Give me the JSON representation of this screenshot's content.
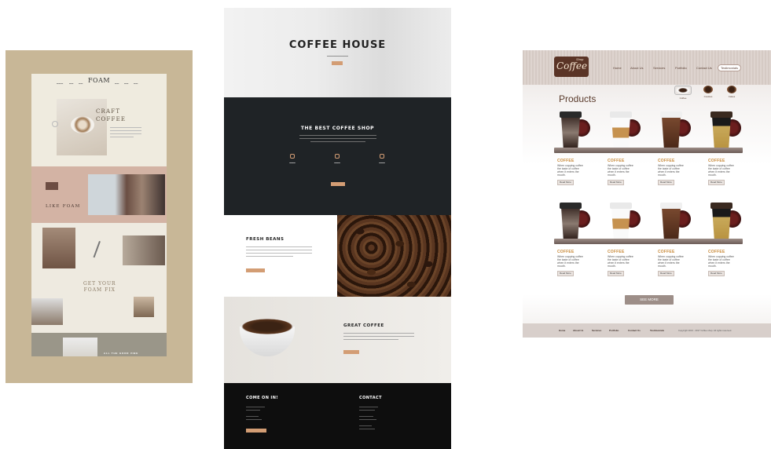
{
  "foam": {
    "logo": "FOAM",
    "hero_heading_line1": "CRAFT",
    "hero_heading_line2": "COFFEE",
    "band_heading": "LIKE FOAM",
    "fix_line1": "GET YOUR",
    "fix_line2": "FOAM FIX",
    "footer_heading": "ALL THE GOOD VIBE"
  },
  "coffee_house": {
    "hero_title": "COFFEE HOUSE",
    "section_title": "THE BEST COFFEE SHOP",
    "beans_title": "FRESH BEANS",
    "great_title": "GREAT COFFEE",
    "footer_left_title": "COME ON IN!",
    "footer_right_title": "CONTACT"
  },
  "coffee_shop": {
    "logo_main": "Coffee",
    "logo_sub": "Shop",
    "nav": [
      "Home",
      "About Us",
      "Services",
      "Portfolio",
      "Contact Us",
      "Testimonials"
    ],
    "page_title": "Products",
    "categories": [
      "Coffee",
      "Cookies",
      "Cakes"
    ],
    "product_title": "COFFEE",
    "product_desc": "When cupping coffee the taste of coffee when it enters the mouth.",
    "read_more": "Read More",
    "see_more": "SEE MORE",
    "footer_nav": [
      "Home",
      "About Us",
      "Services",
      "Portfolio",
      "Contact Us",
      "Testimonials"
    ],
    "copyright": "Copyright 2013 - 2017 Coffee shop. All rights reserved."
  },
  "colors": {
    "foam_bg": "#c8b797",
    "coffee_house_dark": "#1f2326",
    "accent_orange": "#d39d74",
    "coffee_shop_brown": "#5a3426"
  }
}
